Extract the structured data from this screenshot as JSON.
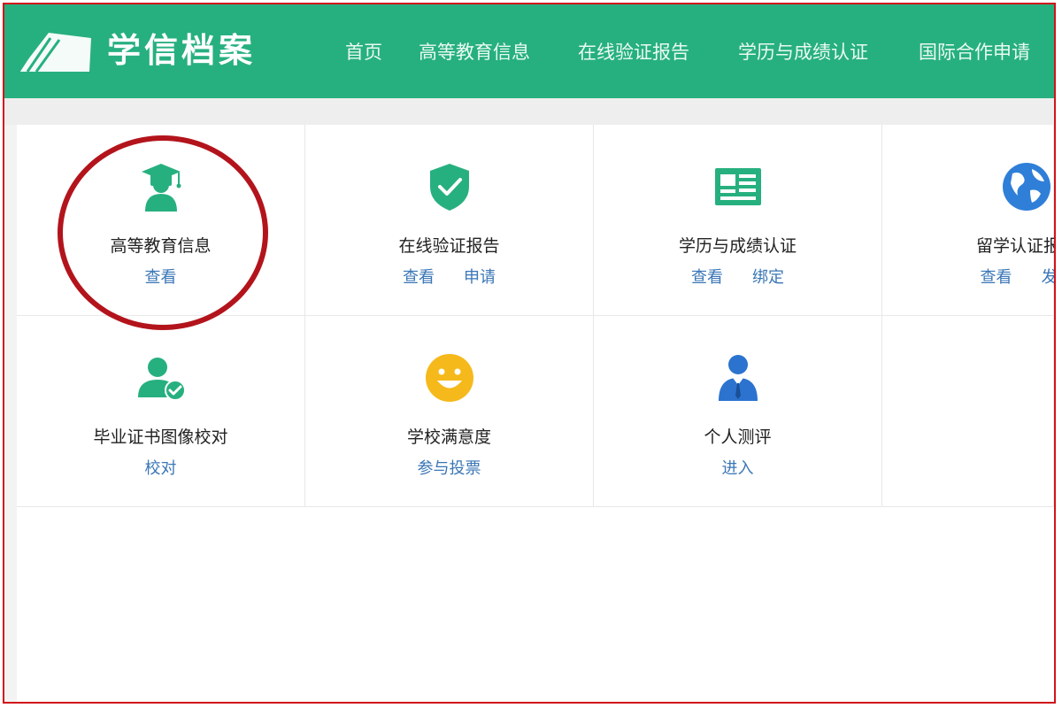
{
  "header": {
    "brand": "学信档案",
    "nav": [
      "首页",
      "高等教育信息",
      "在线验证报告",
      "学历与成绩认证",
      "国际合作申请"
    ]
  },
  "services": [
    {
      "title": "高等教育信息",
      "links": [
        "查看"
      ],
      "icon": "graduate-cap-icon"
    },
    {
      "title": "在线验证报告",
      "links": [
        "查看",
        "申请"
      ],
      "icon": "shield-check-icon"
    },
    {
      "title": "学历与成绩认证",
      "links": [
        "查看",
        "绑定"
      ],
      "icon": "certificate-icon"
    },
    {
      "title": "留学认证报告",
      "links": [
        "查看",
        "发送"
      ],
      "icon": "globe-icon"
    },
    {
      "title": "毕业证书图像校对",
      "links": [
        "校对"
      ],
      "icon": "user-check-icon"
    },
    {
      "title": "学校满意度",
      "links": [
        "参与投票"
      ],
      "icon": "smiley-icon"
    },
    {
      "title": "个人测评",
      "links": [
        "进入"
      ],
      "icon": "person-suit-icon"
    }
  ],
  "colors": {
    "header_bg": "#27b07f",
    "icon_green": "#27b07f",
    "link_blue": "#3a76b6",
    "frame_red": "#d0141b",
    "circle_red": "#b3141c",
    "smiley_yellow": "#f5b91b",
    "globe_blue": "#2f7fd8",
    "person_blue": "#2b73cf"
  }
}
